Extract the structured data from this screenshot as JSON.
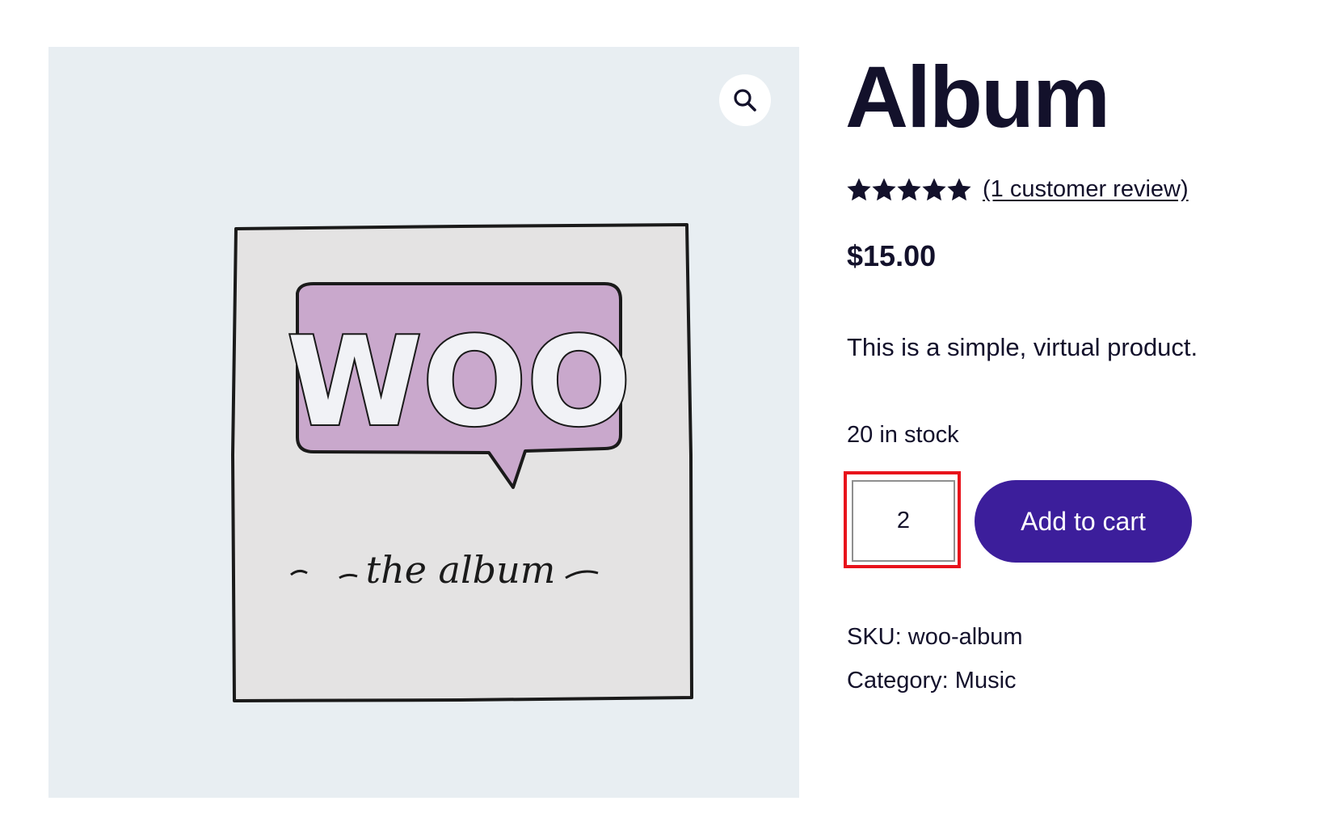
{
  "product": {
    "title": "Album",
    "rating": {
      "stars": 5,
      "max_stars": 5,
      "review_link": "(1 customer review)"
    },
    "price": "$15.00",
    "description": "This is a simple, virtual product.",
    "stock": "20 in stock",
    "quantity": "2",
    "add_to_cart_label": "Add to cart",
    "sku_label": "SKU:",
    "sku_value": "woo-album",
    "category_label": "Category:",
    "category_value": "Music"
  },
  "gallery": {
    "zoom_icon": "magnifier-icon",
    "image_logo_text": "WOO",
    "image_caption": "the album"
  },
  "colors": {
    "gallery_bg": "#e8eef2",
    "button_bg": "#3c1e9b",
    "text": "#13112b",
    "highlight": "#e8121b",
    "woo_bubble": "#c9a8cc"
  }
}
